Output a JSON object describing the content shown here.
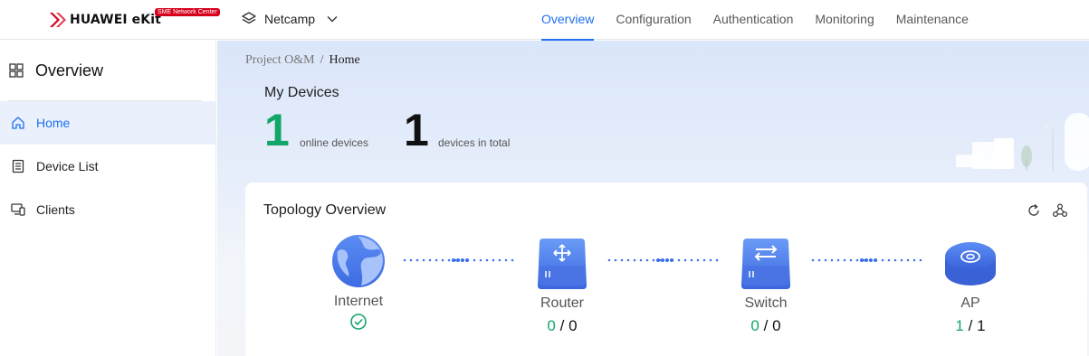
{
  "header": {
    "brand": "HUAWEI eKit",
    "brand_badge": "SME Network Center",
    "project_name": "Netcamp",
    "nav": [
      {
        "label": "Overview",
        "active": true
      },
      {
        "label": "Configuration",
        "active": false
      },
      {
        "label": "Authentication",
        "active": false
      },
      {
        "label": "Monitoring",
        "active": false
      },
      {
        "label": "Maintenance",
        "active": false
      }
    ]
  },
  "sidebar": {
    "title": "Overview",
    "items": [
      {
        "label": "Home",
        "icon": "home-icon",
        "active": true
      },
      {
        "label": "Device List",
        "icon": "device-list-icon",
        "active": false
      },
      {
        "label": "Clients",
        "icon": "clients-icon",
        "active": false
      }
    ]
  },
  "breadcrumb": {
    "parent": "Project O&M",
    "separator": "/",
    "current": "Home"
  },
  "my_devices": {
    "title": "My Devices",
    "online_count": "1",
    "online_label": "online devices",
    "total_count": "1",
    "total_label": "devices in total"
  },
  "topology": {
    "title": "Topology Overview",
    "nodes": [
      {
        "label": "Internet",
        "status": "connected"
      },
      {
        "label": "Router",
        "online": "0",
        "total": "0"
      },
      {
        "label": "Switch",
        "online": "0",
        "total": "0"
      },
      {
        "label": "AP",
        "online": "1",
        "total": "1"
      }
    ],
    "count_separator": "/"
  },
  "colors": {
    "accent": "#1f6ff0",
    "online_green": "#12a668",
    "brand_red": "#d6001c"
  }
}
